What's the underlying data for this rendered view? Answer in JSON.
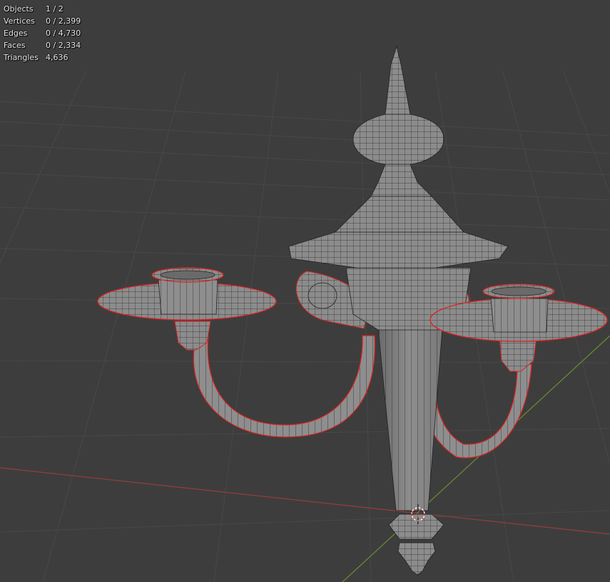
{
  "statistics": {
    "rows": [
      {
        "label": "Objects",
        "value": "1 / 2"
      },
      {
        "label": "Vertices",
        "value": "0 / 2,399"
      },
      {
        "label": "Edges",
        "value": "0 / 4,730"
      },
      {
        "label": "Faces",
        "value": "0 / 2,334"
      },
      {
        "label": "Triangles",
        "value": "4,636"
      }
    ]
  },
  "colors": {
    "background": "#3d3d3d",
    "grid_line": "#4a4a4a",
    "x_axis": "#9a3c3c",
    "y_axis": "#6a8f2e",
    "selection_outline": "#e02020",
    "mesh_fill": "#8e8e8e",
    "wire": "#222222",
    "cursor": "#e04848"
  }
}
